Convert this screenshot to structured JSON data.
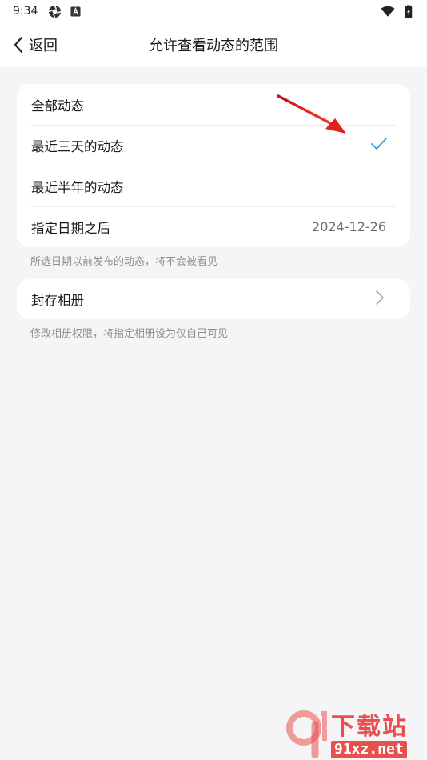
{
  "status_bar": {
    "time": "9:34",
    "icons": [
      "aperture-icon",
      "a-box-icon",
      "wifi-icon",
      "battery-charging-icon"
    ]
  },
  "nav": {
    "back_label": "返回",
    "title": "允许查看动态的范围"
  },
  "visibility_options": [
    {
      "label": "全部动态",
      "selected": false
    },
    {
      "label": "最近三天的动态",
      "selected": true
    },
    {
      "label": "最近半年的动态",
      "selected": false
    },
    {
      "label": "指定日期之后",
      "value": "2024-12-26",
      "selected": false
    }
  ],
  "hint_after_options": "所选日期以前发布的动态，将不会被看见",
  "album": {
    "label": "封存相册",
    "hint": "修改相册权限，将指定相册设为仅自己可见"
  },
  "watermark": {
    "cn": "下载站",
    "en": "91xz.net"
  },
  "colors": {
    "accent": "#2fa3d8",
    "background": "#f5f5f7",
    "annotation_arrow": "#e3201b",
    "watermark": "#e8504d"
  }
}
